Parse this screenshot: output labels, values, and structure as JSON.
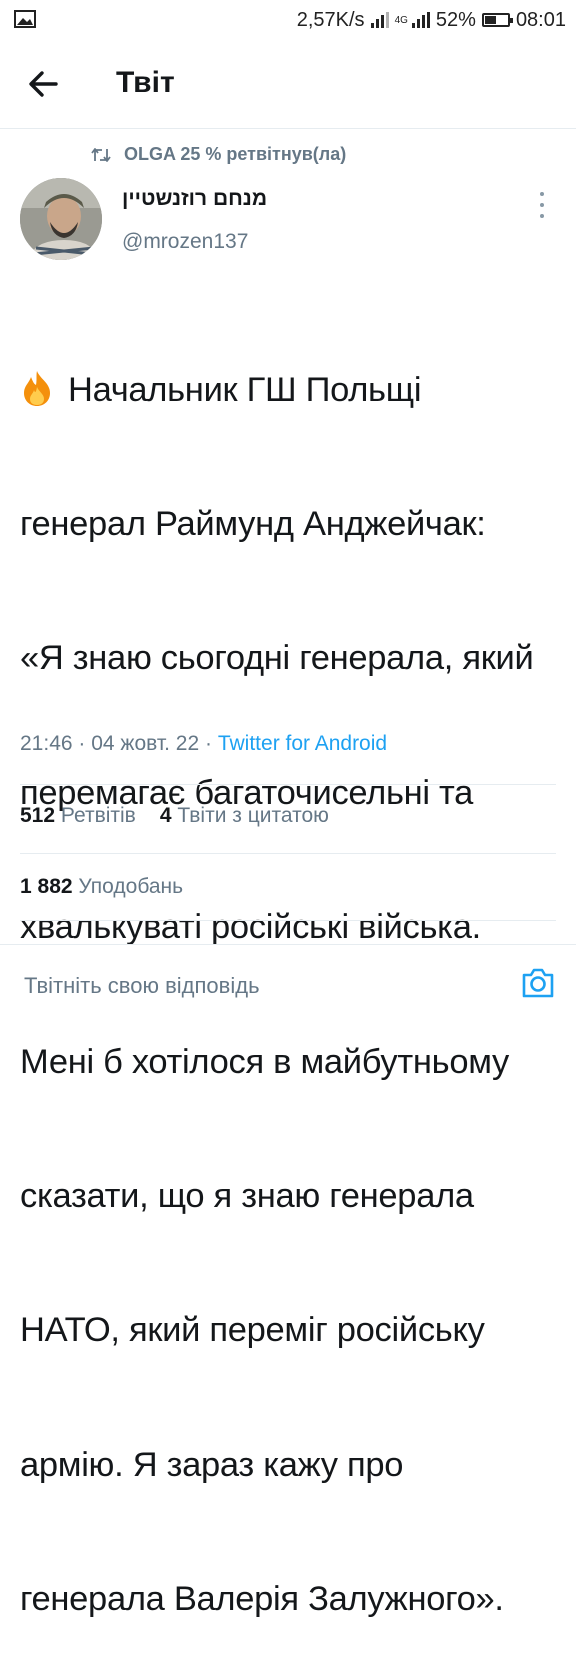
{
  "status_bar": {
    "speed": "2,57K/s",
    "network": "4G",
    "battery": "52%",
    "battery_level": 0.52,
    "time": "08:01"
  },
  "header": {
    "title": "Твіт"
  },
  "retweet": {
    "text": "OLGA 25 % ретвітнув(ла)"
  },
  "author": {
    "name": "מנחם רוזנשטיין",
    "handle": "@mrozen137"
  },
  "tweet": {
    "lines": [
      "Начальник ГШ Польщі",
      "генерал Раймунд Анджейчак:",
      "«Я знаю сьогодні генерала, який",
      "перемагає багаточисельні та",
      "хвалькуваті російські війська.",
      "Мені б хотілося в майбутньому",
      "сказати, що я знаю генерала",
      "НАТО, який переміг російську",
      "армію. Я зараз кажу про",
      "генерала Валерія Залужного»."
    ],
    "time": "21:46",
    "date": "04 жовт. 22",
    "source": "Twitter for Android"
  },
  "stats": {
    "retweets_count": "512",
    "retweets_label": "Ретвітів",
    "quotes_count": "4",
    "quotes_label": "Твіти з цитатою",
    "likes_count": "1 882",
    "likes_label": "Уподобань"
  },
  "reply": {
    "placeholder": "Твітніть свою відповідь"
  },
  "icons": {
    "image": "image-icon",
    "back": "arrow-left-icon",
    "retweet": "retweet-icon",
    "more": "more-vertical-icon",
    "fire": "fire-emoji",
    "camera": "camera-icon"
  },
  "colors": {
    "accent": "#1da1f2",
    "secondary_text": "#657786",
    "primary_text": "#14171a"
  }
}
